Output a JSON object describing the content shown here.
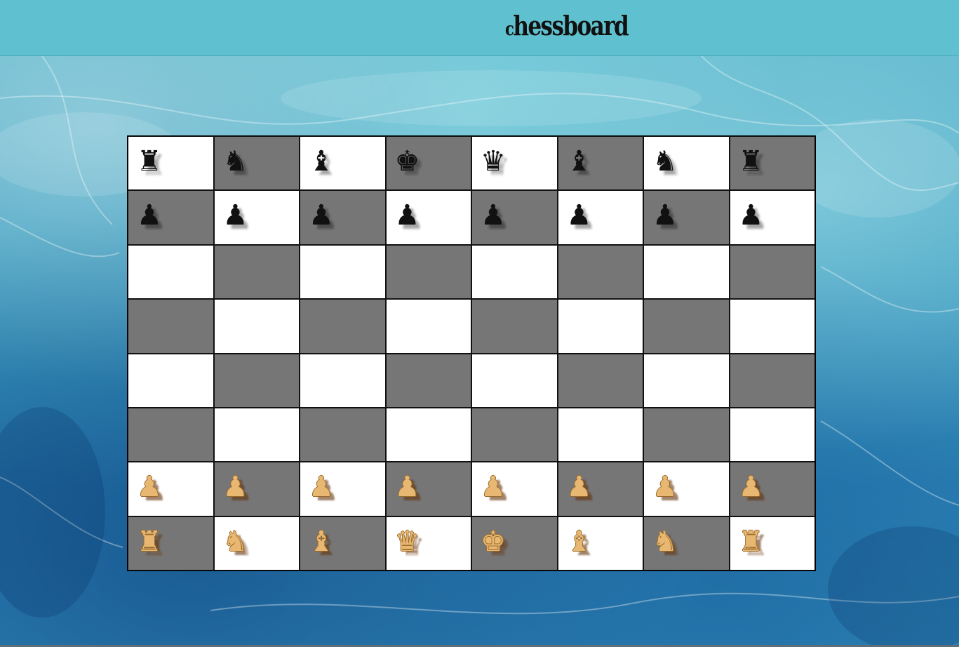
{
  "header": {
    "title": "hessboard",
    "title_initial": "c"
  },
  "colors": {
    "header_bg": "#5fc1cf",
    "light_square": "#ffffff",
    "dark_square": "#767676",
    "black_piece": "#111111",
    "white_piece": "#e8b872"
  },
  "board": {
    "top_square_color": "light",
    "rows": [
      [
        "black-rook",
        "black-knight",
        "black-bishop",
        "black-king",
        "black-queen",
        "black-bishop",
        "black-knight",
        "black-rook"
      ],
      [
        "black-pawn",
        "black-pawn",
        "black-pawn",
        "black-pawn",
        "black-pawn",
        "black-pawn",
        "black-pawn",
        "black-pawn"
      ],
      [
        "",
        "",
        "",
        "",
        "",
        "",
        "",
        ""
      ],
      [
        "",
        "",
        "",
        "",
        "",
        "",
        "",
        ""
      ],
      [
        "",
        "",
        "",
        "",
        "",
        "",
        "",
        ""
      ],
      [
        "",
        "",
        "",
        "",
        "",
        "",
        "",
        ""
      ],
      [
        "white-pawn",
        "white-pawn",
        "white-pawn",
        "white-pawn",
        "white-pawn",
        "white-pawn",
        "white-pawn",
        "white-pawn"
      ],
      [
        "white-rook",
        "white-knight",
        "white-bishop",
        "white-queen",
        "white-king",
        "white-bishop",
        "white-knight",
        "white-rook"
      ]
    ]
  },
  "glyphs": {
    "black-rook": "♜",
    "black-knight": "♞",
    "black-bishop": "♝",
    "black-queen": "♛",
    "black-king": "♚",
    "black-pawn": "♟",
    "white-rook": "♜",
    "white-knight": "♞",
    "white-bishop": "♝",
    "white-queen": "♛",
    "white-king": "♚",
    "white-pawn": "♟"
  }
}
